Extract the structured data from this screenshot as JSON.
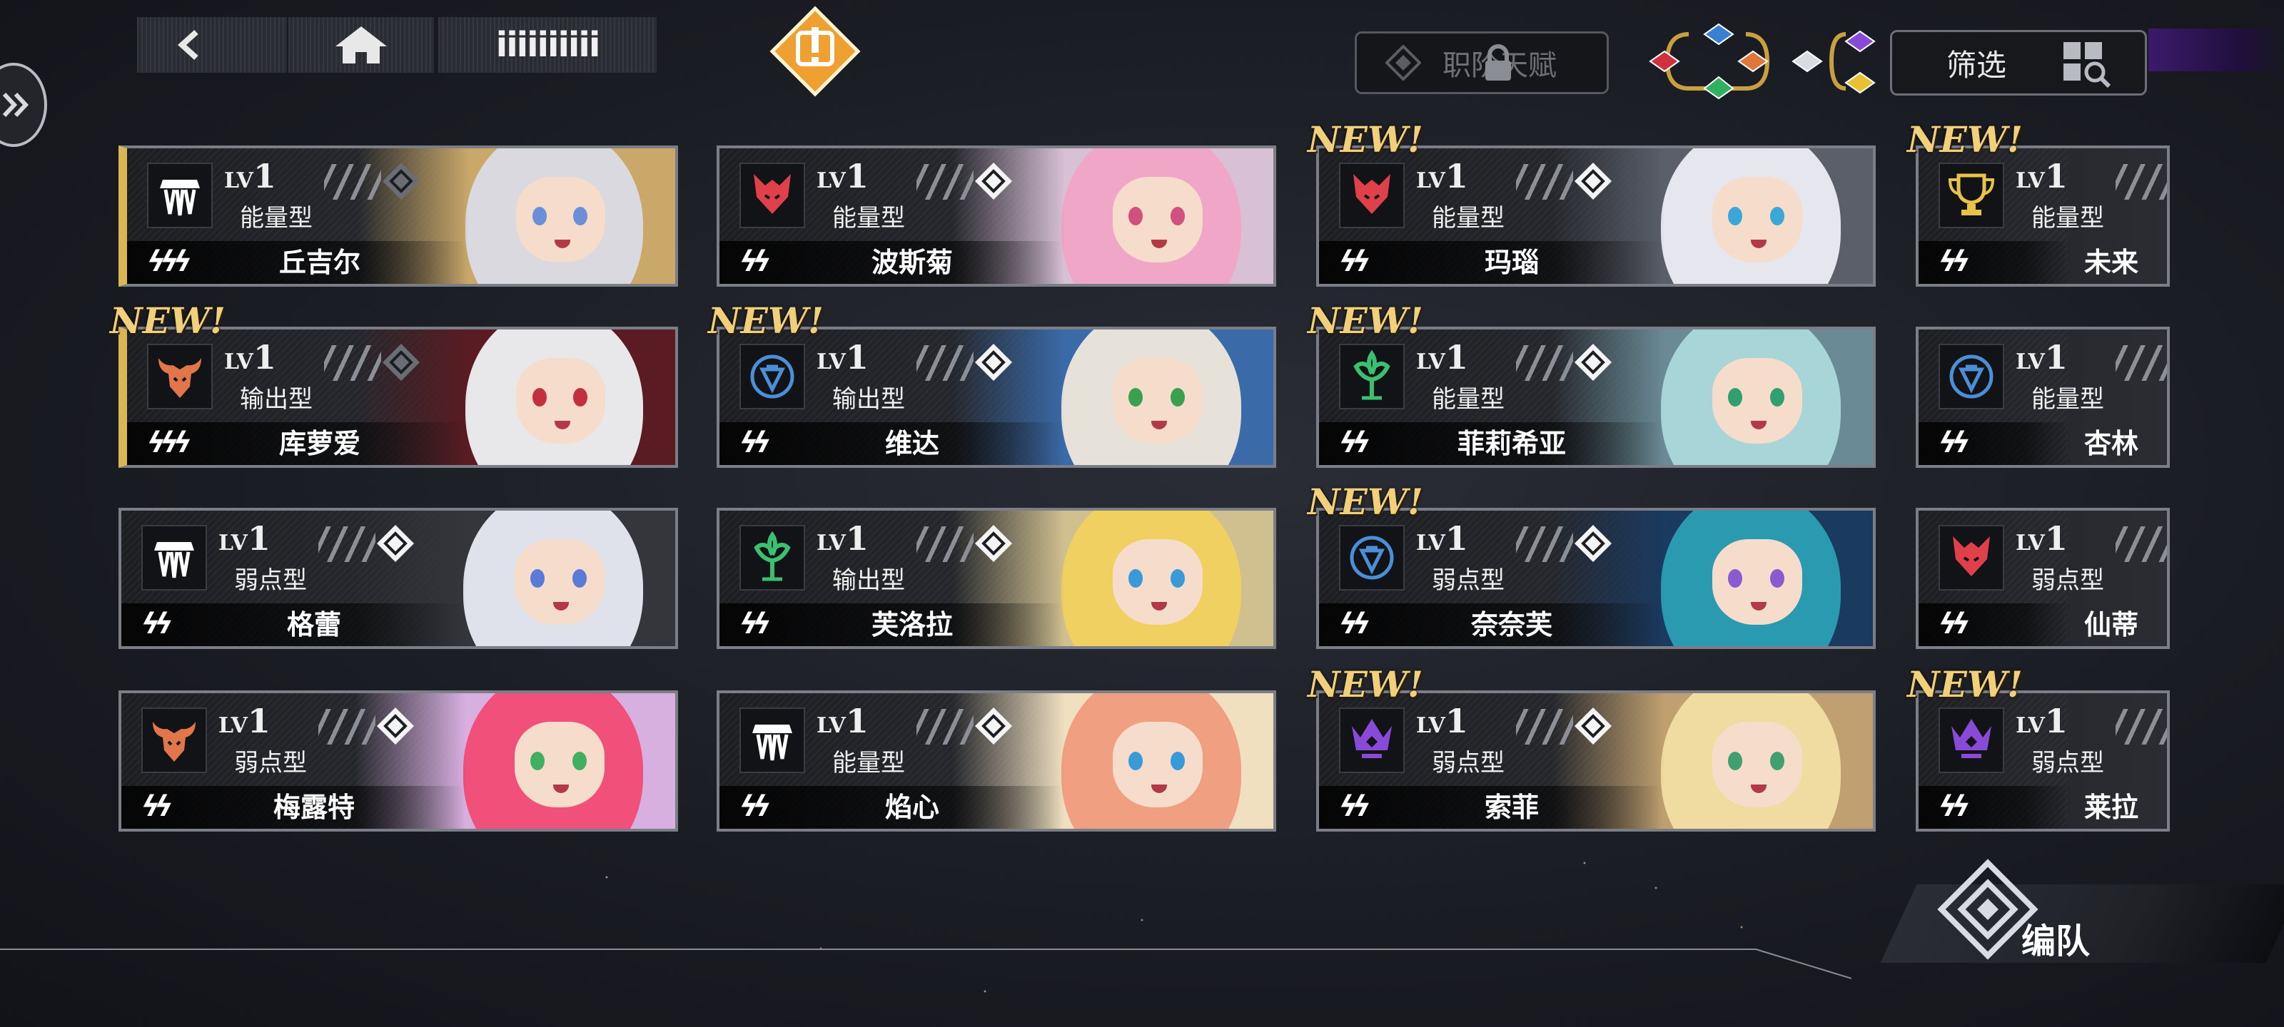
{
  "topbar": {
    "title_text": "iiiiiiiiii",
    "talent_label": "职阶天赋",
    "filter_label": "筛选"
  },
  "cards": [
    {
      "type": "能量型",
      "name": "丘吉尔",
      "lv_prefix": "LV",
      "lv": "1",
      "new": false,
      "gold": true,
      "element": "wing",
      "elementColor": "#ffffff",
      "hair": "#d9d9df",
      "eye": "#6b8ed8",
      "bg": "#c9a86a"
    },
    {
      "type": "能量型",
      "name": "波斯菊",
      "lv_prefix": "LV",
      "lv": "1",
      "new": false,
      "gold": false,
      "element": "wolf",
      "elementColor": "#e0404a",
      "hair": "#f0a6c6",
      "eye": "#d05080",
      "bg": "#d8c0d6"
    },
    {
      "type": "能量型",
      "name": "玛瑙",
      "lv_prefix": "LV",
      "lv": "1",
      "new": true,
      "gold": false,
      "element": "wolf",
      "elementColor": "#e0404a",
      "hair": "#e6e6ee",
      "eye": "#3aa7d8",
      "bg": "#5a5f6a"
    },
    {
      "type": "能量型",
      "name": "未来",
      "lv_prefix": "LV",
      "lv": "1",
      "new": true,
      "gold": false,
      "element": "trophy",
      "elementColor": "#e8c24a",
      "hair": "#2b2d33",
      "eye": "#2b2d33",
      "bg": "#2b2d33"
    },
    {
      "type": "输出型",
      "name": "库萝爱",
      "lv_prefix": "LV",
      "lv": "1",
      "new": true,
      "gold": true,
      "element": "ox",
      "elementColor": "#e0764a",
      "hair": "#e8e8ea",
      "eye": "#c23040",
      "bg": "#5a1c22"
    },
    {
      "type": "输出型",
      "name": "维达",
      "lv_prefix": "LV",
      "lv": "1",
      "new": true,
      "gold": false,
      "element": "shield",
      "elementColor": "#4a8fd8",
      "hair": "#e6e2da",
      "eye": "#3aa050",
      "bg": "#3a6aa8"
    },
    {
      "type": "能量型",
      "name": "菲莉希亚",
      "lv_prefix": "LV",
      "lv": "1",
      "new": true,
      "gold": false,
      "element": "tree",
      "elementColor": "#3ac070",
      "hair": "#a8d6d8",
      "eye": "#30a070",
      "bg": "#6a8a96"
    },
    {
      "type": "能量型",
      "name": "杏林",
      "lv_prefix": "LV",
      "lv": "1",
      "new": false,
      "gold": false,
      "element": "shield",
      "elementColor": "#4a8fd8",
      "hair": "#2b2d33",
      "eye": "#2b2d33",
      "bg": "#2b2d33"
    },
    {
      "type": "弱点型",
      "name": "格蕾",
      "lv_prefix": "LV",
      "lv": "1",
      "new": false,
      "gold": false,
      "element": "wing",
      "elementColor": "#ffffff",
      "hair": "#dfe2ea",
      "eye": "#5a7ad8",
      "bg": "#34363c"
    },
    {
      "type": "输出型",
      "name": "芙洛拉",
      "lv_prefix": "LV",
      "lv": "1",
      "new": false,
      "gold": false,
      "element": "tree",
      "elementColor": "#3ac070",
      "hair": "#f0d060",
      "eye": "#3a9ad8",
      "bg": "#d0c090"
    },
    {
      "type": "弱点型",
      "name": "奈奈芙",
      "lv_prefix": "LV",
      "lv": "1",
      "new": true,
      "gold": false,
      "element": "shield",
      "elementColor": "#4a8fd8",
      "hair": "#2a9ab0",
      "eye": "#8a5ad0",
      "bg": "#1a3a60"
    },
    {
      "type": "弱点型",
      "name": "仙蒂",
      "lv_prefix": "LV",
      "lv": "1",
      "new": false,
      "gold": false,
      "element": "wolf",
      "elementColor": "#e0404a",
      "hair": "#2b2d33",
      "eye": "#2b2d33",
      "bg": "#2b2d33"
    },
    {
      "type": "弱点型",
      "name": "梅露特",
      "lv_prefix": "LV",
      "lv": "1",
      "new": false,
      "gold": false,
      "element": "ox",
      "elementColor": "#e0764a",
      "hair": "#f0507a",
      "eye": "#40b060",
      "bg": "#d8b0e0"
    },
    {
      "type": "能量型",
      "name": "焰心",
      "lv_prefix": "LV",
      "lv": "1",
      "new": false,
      "gold": false,
      "element": "wing",
      "elementColor": "#ffffff",
      "hair": "#f0a080",
      "eye": "#3a9ad8",
      "bg": "#f0e0c0"
    },
    {
      "type": "弱点型",
      "name": "索菲",
      "lv_prefix": "LV",
      "lv": "1",
      "new": true,
      "gold": false,
      "element": "crown",
      "elementColor": "#8a4ad8",
      "hair": "#f0dca0",
      "eye": "#40a070",
      "bg": "#c0a070"
    },
    {
      "type": "弱点型",
      "name": "莱拉",
      "lv_prefix": "LV",
      "lv": "1",
      "new": true,
      "gold": false,
      "element": "crown",
      "elementColor": "#8a4ad8",
      "hair": "#2b2d33",
      "eye": "#2b2d33",
      "bg": "#5a1c3a"
    }
  ],
  "new_label": "NEW!",
  "formation_label": "编队"
}
